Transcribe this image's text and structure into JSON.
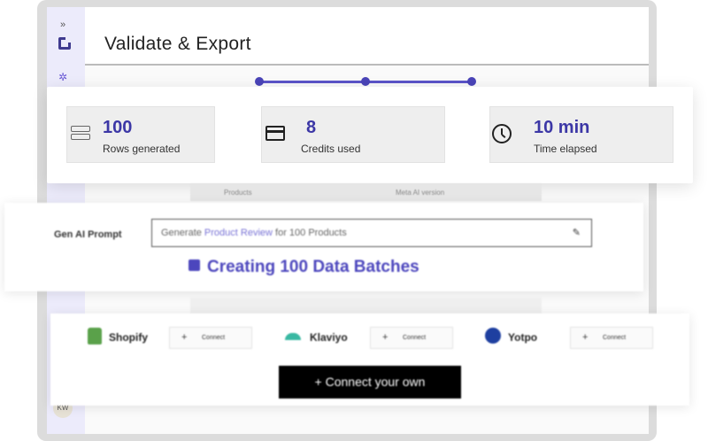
{
  "page": {
    "title": "Validate & Export"
  },
  "rail": {
    "expand_icon": "double-chevron-right-icon",
    "avatar_initials": "KW"
  },
  "stepper": {
    "steps_visible": 3
  },
  "stats": [
    {
      "value": "100",
      "label": "Rows generated",
      "icon": "rows-icon"
    },
    {
      "value": "8",
      "label": "Credits used",
      "icon": "credit-card-icon"
    },
    {
      "value": "10 min",
      "label": "Time elapsed",
      "icon": "clock-icon"
    }
  ],
  "faded_tabs": {
    "left": "Products",
    "right": "Meta AI version"
  },
  "prompt": {
    "label": "Gen AI Prompt",
    "prefix": "Generate ",
    "highlight": "Product Review",
    "suffix": " for 100 Products",
    "status": "Creating 100 Data Batches"
  },
  "integrations": [
    {
      "name": "Shopify",
      "button": "Connect"
    },
    {
      "name": "Klaviyo",
      "button": "Connect"
    },
    {
      "name": "Yotpo",
      "button": "Connect"
    }
  ],
  "connect_own": "+ Connect your own",
  "colors": {
    "accent": "#3c37a6",
    "rail_bg": "#ecebfb",
    "button_dark": "#000000"
  }
}
